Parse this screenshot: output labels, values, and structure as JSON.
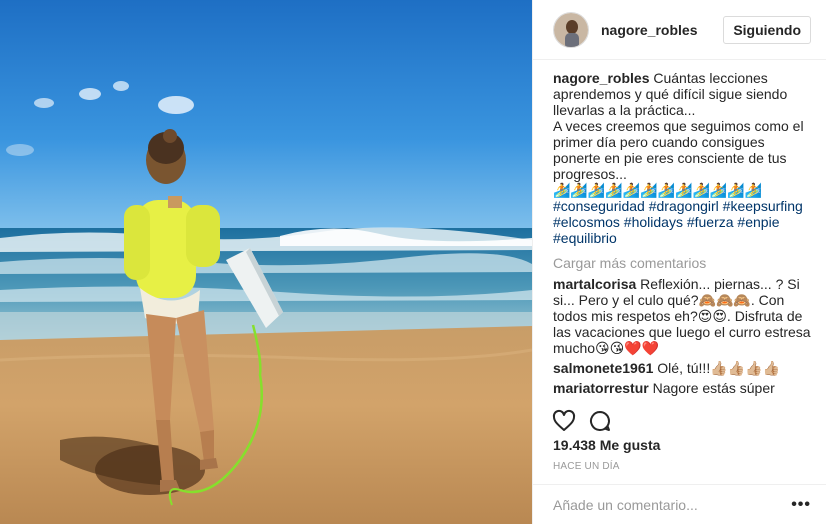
{
  "post": {
    "image_alt": "surfer walking on beach with surfboard",
    "author": "nagore_robles",
    "follow_label": "Siguiendo",
    "caption": {
      "user": "nagore_robles",
      "text": " Cuántas lecciones aprendemos y qué difícil sigue siendo llevarlas a la práctica...\nA veces creemos que seguimos como el primer día pero cuando consigues ponerte en pie eres consciente de tus progresos...\n🏄🏄🏄🏄🏄🏄🏄🏄🏄🏄🏄🏄\n",
      "hashtags": "#conseguridad #dragongirl #keepsurfing #elcosmos #holidays #fuerza #enpie #equilibrio"
    },
    "load_more": "Cargar más comentarios",
    "comments": [
      {
        "user": "martalcorisa",
        "text": " Reflexión... piernas... ? Si si... Pero y el culo qué?🙈🙈🙈. Con todos mis respetos eh?😍😍. Disfruta de las vacaciones que luego el curro estresa mucho😘😘❤️❤️"
      },
      {
        "user": "salmonete1961",
        "text": " Olé, tú!!!👍🏼👍🏼👍🏼👍🏼"
      },
      {
        "user": "mariatorrestur",
        "text": " Nagore estás súper guapa"
      }
    ],
    "likes": "19.438 Me gusta",
    "time": "Hace un día",
    "comment_placeholder": "Añade un comentario...",
    "more_label": "•••",
    "icons": {
      "like": "heart-icon",
      "comment": "comment-bubble-icon",
      "more": "more-options-icon"
    }
  }
}
